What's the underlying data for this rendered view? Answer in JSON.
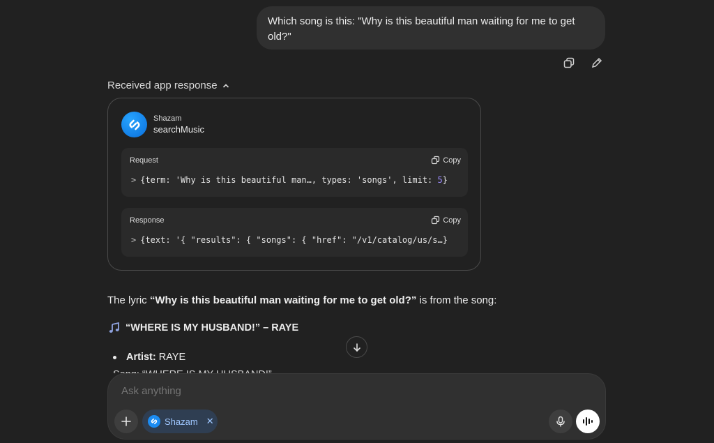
{
  "user_message": "Which song is this: \"Why is this beautiful man waiting for me to get old?\"",
  "app_response": {
    "toggle_label": "Received app response",
    "app_name": "Shazam",
    "function_name": "searchMusic",
    "request": {
      "label": "Request",
      "copy_label": "Copy",
      "code_prefix": "{term: 'Why is this beautiful man…, types: 'songs', limit: ",
      "code_number": "5",
      "code_suffix": "}"
    },
    "response": {
      "label": "Response",
      "copy_label": "Copy",
      "code": "{text: '{ \"results\": { \"songs\": { \"href\": \"/v1/catalog/us/s…}"
    }
  },
  "answer": {
    "intro_before": "The lyric ",
    "lyric_bold": "“Why is this beautiful man waiting for me to get old?”",
    "intro_after": " is from the song:",
    "song_title": "“WHERE IS MY HUSBAND!” – RAYE",
    "artist_label": "Artist:",
    "artist_value": " RAYE",
    "cut_line": "Song: “WHERE IS MY HUSBAND!”"
  },
  "composer": {
    "placeholder": "Ask anything",
    "chip_label": "Shazam"
  },
  "colors": {
    "background": "#212121",
    "bubble": "#303030",
    "chip_bg": "#2f3e52",
    "chip_text": "#9fc7ff",
    "shazam_blue": "#1b8cf3",
    "number_purple": "#9d8cff"
  }
}
